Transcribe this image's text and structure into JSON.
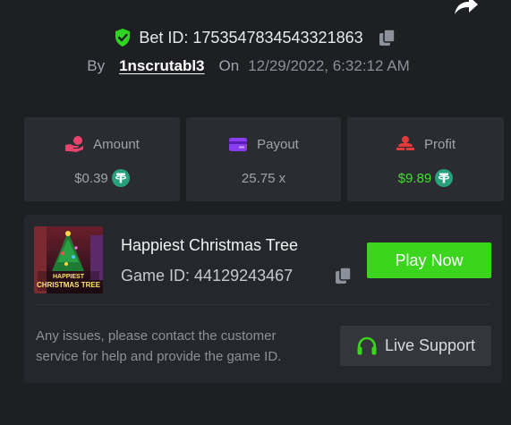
{
  "bet": {
    "label": "Bet ID:",
    "id": "1753547834543321863",
    "by_label": "By",
    "username": "1nscrutabl3",
    "on_label": "On",
    "date": "12/29/2022, 6:32:12 AM"
  },
  "stats": [
    {
      "label": "Amount",
      "value": "$0.39",
      "icon": "hand-coin-icon",
      "value_color": "#9fa3ad",
      "currency": "tether-icon"
    },
    {
      "label": "Payout",
      "value": "25.75 x",
      "icon": "card-icon"
    },
    {
      "label": "Profit",
      "value": "$9.89",
      "icon": "person-money-icon",
      "value_color": "#3ee22b",
      "currency": "tether-icon"
    }
  ],
  "game": {
    "title": "Happiest Christmas Tree",
    "id_label": "Game ID:",
    "id": "44129243467",
    "thumb_line1": "HAPPIEST",
    "thumb_line2": "CHRISTMAS TREE",
    "play_label": "Play Now"
  },
  "support": {
    "text": "Any issues, please contact the customer service for help and provide the game ID.",
    "button_label": "Live Support"
  },
  "colors": {
    "background": "#1e1f23",
    "card": "#2a2c32",
    "accent_green": "#3cd51e",
    "amount_icon": "#e8436a",
    "payout_icon": "#8a3cf0",
    "profit_icon": "#e53a3a"
  }
}
